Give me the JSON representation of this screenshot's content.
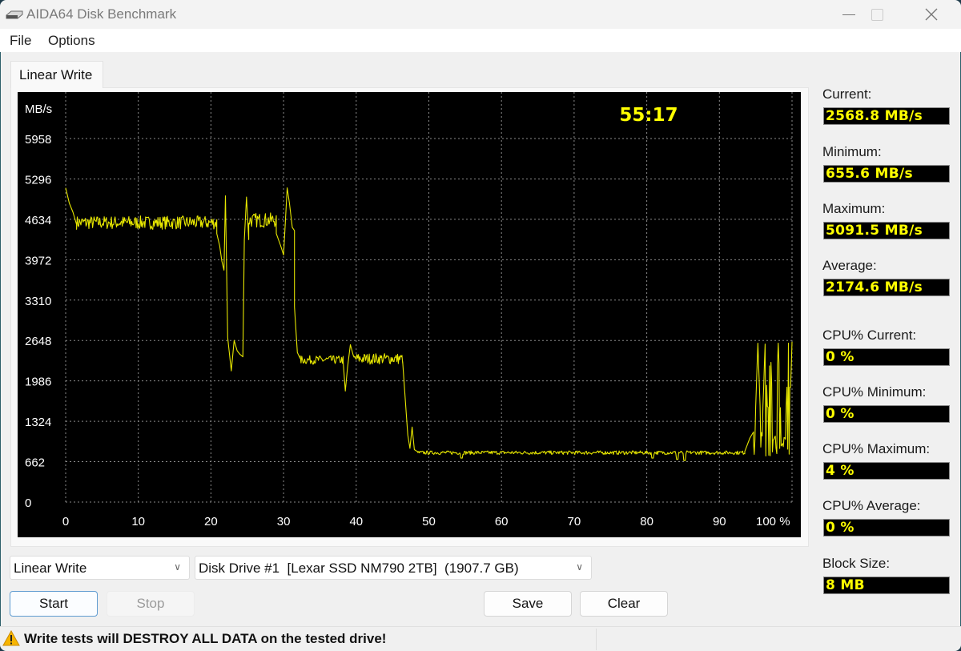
{
  "window": {
    "title": "AIDA64 Disk Benchmark",
    "icon": "disk-drive-icon",
    "controls": {
      "minimize": "minimize-icon",
      "maximize": "maximize-icon",
      "close": "close-icon"
    }
  },
  "menu": {
    "items": [
      "File",
      "Options"
    ]
  },
  "tabs": [
    {
      "label": "Linear Write",
      "active": true
    }
  ],
  "timer": "55:17",
  "stats": [
    {
      "label": "Current:",
      "value": "2568.8 MB/s"
    },
    {
      "label": "Minimum:",
      "value": "655.6 MB/s"
    },
    {
      "label": "Maximum:",
      "value": "5091.5 MB/s"
    },
    {
      "label": "Average:",
      "value": "2174.6 MB/s"
    },
    {
      "label": "CPU% Current:",
      "value": "0 %"
    },
    {
      "label": "CPU% Minimum:",
      "value": "0 %"
    },
    {
      "label": "CPU% Maximum:",
      "value": "4 %"
    },
    {
      "label": "CPU% Average:",
      "value": "0 %"
    },
    {
      "label": "Block Size:",
      "value": "8 MB"
    }
  ],
  "controls": {
    "test_select": "Linear Write",
    "drive_select": "Disk Drive #1  [Lexar SSD NM790 2TB]  (1907.7 GB)",
    "start": "Start",
    "stop": "Stop",
    "save": "Save",
    "clear": "Clear"
  },
  "status": {
    "warning_icon": "warning-icon",
    "text": "Write tests will DESTROY ALL DATA on the tested drive!"
  },
  "colors": {
    "line": "#e6e600",
    "value_text": "#ffff00",
    "chart_bg": "#000000",
    "grid": "#8a8a8a"
  },
  "chart_data": {
    "type": "line",
    "title": "Linear Write",
    "ylabel": "MB/s",
    "xlabel": "%",
    "ylim": [
      0,
      5958
    ],
    "xlim": [
      0,
      100
    ],
    "yticks": [
      0,
      662,
      1324,
      1986,
      2648,
      3310,
      3972,
      4634,
      5296,
      5958
    ],
    "xticks": [
      0,
      10,
      20,
      30,
      40,
      50,
      60,
      70,
      80,
      90,
      100
    ],
    "xtick_labels": [
      "0",
      "10",
      "20",
      "30",
      "40",
      "50",
      "60",
      "70",
      "80",
      "90",
      "100 %"
    ],
    "grid": true,
    "series": [
      {
        "name": "Linear Write",
        "segments": [
          {
            "x": [
              0,
              0.5,
              1,
              1.5
            ],
            "y": [
              5150,
              4900,
              4750,
              4550
            ]
          },
          {
            "x_range": [
              1.5,
              20.8
            ],
            "mean": 4580,
            "noise": 110
          },
          {
            "x": [
              20.8,
              21.2,
              21.5,
              21.8,
              22.0,
              22.3,
              22.5,
              22.8,
              23.2,
              23.6,
              24.0,
              24.4
            ],
            "y": [
              4400,
              4200,
              3950,
              3800,
              5020,
              2700,
              2480,
              2150,
              2650,
              2480,
              2420,
              2380
            ]
          },
          {
            "x": [
              24.4,
              24.6,
              24.9,
              25.2
            ],
            "y": [
              2400,
              4300,
              5000,
              4300
            ]
          },
          {
            "x_range": [
              25.2,
              29.0
            ],
            "mean": 4620,
            "noise": 120
          },
          {
            "x": [
              29.0,
              29.6,
              30.0,
              30.5,
              30.8,
              31.2,
              31.5
            ],
            "y": [
              4400,
              4200,
              4050,
              5150,
              4900,
              4500,
              4450
            ]
          },
          {
            "x": [
              31.5,
              31.9,
              32.3
            ],
            "y": [
              3200,
              2450,
              2350
            ]
          },
          {
            "x_range": [
              32.3,
              38.2
            ],
            "mean": 2330,
            "noise": 70
          },
          {
            "x": [
              38.2,
              38.5,
              38.8,
              39.2,
              39.6
            ],
            "y": [
              2300,
              1820,
              2200,
              2580,
              2400
            ]
          },
          {
            "x_range": [
              39.6,
              46.4
            ],
            "mean": 2350,
            "noise": 90
          },
          {
            "x": [
              46.4,
              46.8,
              47.1,
              47.4,
              47.7,
              48.0,
              48.4
            ],
            "y": [
              2300,
              1600,
              1100,
              880,
              1230,
              860,
              830
            ]
          },
          {
            "x_range": [
              48.4,
              93.5
            ],
            "mean": 810,
            "noise": 30,
            "dips": [
              [
                54.5,
                720
              ],
              [
                80.8,
                720
              ],
              [
                84.2,
                700
              ],
              [
                85.2,
                680
              ]
            ]
          },
          {
            "x": [
              93.5,
              94.2,
              94.7
            ],
            "y": [
              830,
              1050,
              1150
            ]
          },
          {
            "x_range": [
              94.7,
              100
            ],
            "mode": "oscillate",
            "low": 900,
            "high": 2580
          }
        ]
      }
    ]
  }
}
